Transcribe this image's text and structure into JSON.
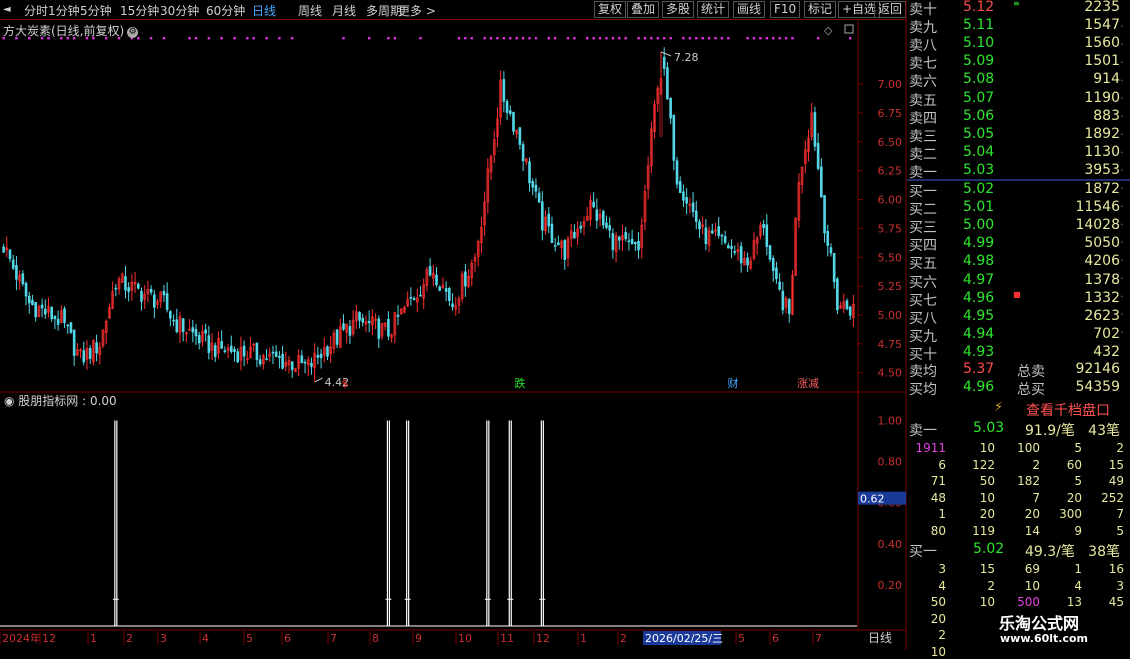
{
  "toolbar": {
    "periods": [
      "分时",
      "1分钟",
      "5分钟",
      "15分钟",
      "30分钟",
      "60分钟",
      "日线",
      "周线",
      "月线",
      "多周期",
      "更多 >"
    ],
    "active": "日线",
    "controls": [
      "复权",
      "叠加",
      "多股",
      "统计",
      "画线",
      "F10",
      "标记",
      "+自选",
      "返回"
    ]
  },
  "stock": {
    "title": "方大炭素(日线,前复权)",
    "high_label": "7.28",
    "low_label": "4.42",
    "gear_glyph": "⚙"
  },
  "main_axis": [
    "7.00",
    "6.75",
    "6.50",
    "6.25",
    "6.00",
    "5.75",
    "5.50",
    "5.25",
    "5.00",
    "4.75",
    "4.50"
  ],
  "event_markers": [
    {
      "label": "$",
      "color": "#ff3030"
    },
    {
      "label": "跌",
      "color": "#2ee62e"
    },
    {
      "label": "财",
      "color": "#4aa8ff"
    },
    {
      "label": "涨减",
      "color": "#ff6060"
    }
  ],
  "indicator": {
    "title": "股朋指标网 : 0.00",
    "axis": [
      "1.00",
      "0.80",
      "0.60",
      "0.40",
      "0.20"
    ],
    "current_value": "0.62"
  },
  "x_axis": {
    "labels": [
      "2024年",
      "12",
      "1",
      "2",
      "3",
      "4",
      "5",
      "6",
      "7",
      "8",
      "9",
      "10",
      "11",
      "12",
      "1",
      "2",
      "5",
      "6",
      "7"
    ],
    "cursor_date": "2026/02/25/三",
    "period_label": "日线"
  },
  "chart_data": {
    "type": "candlestick",
    "title": "方大炭素(日线,前复权)",
    "ylim": [
      4.35,
      7.4
    ],
    "range_high": 7.28,
    "range_low": 4.42,
    "signal_days": [
      35,
      120,
      126,
      151,
      158,
      168
    ],
    "signal_value": 1.0,
    "indicator_ylim": [
      0,
      1.1
    ]
  },
  "quote": {
    "asks": [
      {
        "name": "卖十",
        "price": "5.12",
        "vol": "2235",
        "mark": "≡"
      },
      {
        "name": "卖九",
        "price": "5.11",
        "vol": "1547"
      },
      {
        "name": "卖八",
        "price": "5.10",
        "vol": "1560"
      },
      {
        "name": "卖七",
        "price": "5.09",
        "vol": "1501"
      },
      {
        "name": "卖六",
        "price": "5.08",
        "vol": "914"
      },
      {
        "name": "卖五",
        "price": "5.07",
        "vol": "1190"
      },
      {
        "name": "卖四",
        "price": "5.06",
        "vol": "883"
      },
      {
        "name": "卖三",
        "price": "5.05",
        "vol": "1892"
      },
      {
        "name": "卖二",
        "price": "5.04",
        "vol": "1130"
      },
      {
        "name": "卖一",
        "price": "5.03",
        "vol": "3953"
      }
    ],
    "bids": [
      {
        "name": "买一",
        "price": "5.02",
        "vol": "1872"
      },
      {
        "name": "买二",
        "price": "5.01",
        "vol": "11546"
      },
      {
        "name": "买三",
        "price": "5.00",
        "vol": "14028"
      },
      {
        "name": "买四",
        "price": "4.99",
        "vol": "5050"
      },
      {
        "name": "买五",
        "price": "4.98",
        "vol": "4206"
      },
      {
        "name": "买六",
        "price": "4.97",
        "vol": "1378"
      },
      {
        "name": "买七",
        "price": "4.96",
        "vol": "1332",
        "mark": "■"
      },
      {
        "name": "买八",
        "price": "4.95",
        "vol": "2623"
      },
      {
        "name": "买九",
        "price": "4.94",
        "vol": "702"
      },
      {
        "name": "买十",
        "price": "4.93",
        "vol": "432"
      }
    ],
    "avg_sell": {
      "label": "卖均",
      "price": "5.37",
      "total_label": "总卖",
      "total": "92146"
    },
    "avg_buy": {
      "label": "买均",
      "price": "4.96",
      "total_label": "总买",
      "total": "54359"
    },
    "view_button": "查看千档盘口",
    "sell1_summary": {
      "label": "卖一",
      "price": "5.03",
      "avg": "91.9/笔",
      "count": "43笔"
    },
    "sell1_queue": [
      [
        "1911",
        "10",
        "100",
        "5",
        "2"
      ],
      [
        "6",
        "122",
        "2",
        "60",
        "15"
      ],
      [
        "71",
        "50",
        "182",
        "5",
        "49"
      ],
      [
        "48",
        "10",
        "7",
        "20",
        "252"
      ],
      [
        "1",
        "20",
        "20",
        "300",
        "7"
      ],
      [
        "80",
        "119",
        "14",
        "9",
        "5"
      ]
    ],
    "buy1_summary": {
      "label": "买一",
      "price": "5.02",
      "avg": "49.3/笔",
      "count": "38笔"
    },
    "buy1_queue": [
      [
        "3",
        "15",
        "69",
        "1",
        "16"
      ],
      [
        "4",
        "2",
        "10",
        "4",
        "3"
      ],
      [
        "50",
        "10",
        "500",
        "13",
        "45"
      ],
      [
        "20",
        "",
        "",
        "",
        ""
      ],
      [
        "2",
        "",
        "",
        "",
        ""
      ],
      [
        "10",
        "",
        "",
        "",
        ""
      ]
    ]
  },
  "watermark": {
    "line1": "乐淘公式网",
    "line2": "www.60lt.com"
  },
  "colors": {
    "up": "#ff3030",
    "down": "#54d8e8",
    "grid": "#7a0000",
    "axis_text": "#c83030",
    "signal": "#ffffff",
    "marker": "#e030e0"
  }
}
